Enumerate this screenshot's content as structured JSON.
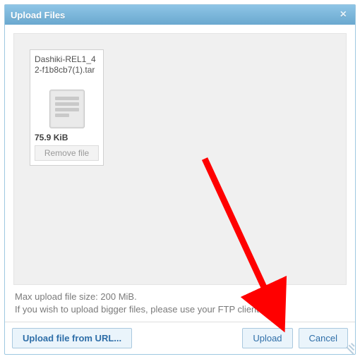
{
  "dialog": {
    "title": "Upload Files",
    "close_glyph": "×"
  },
  "file": {
    "name": "Dashiki-REL1_42-f1b8cb7(1).tar",
    "size": "75.9 KiB",
    "remove_label": "Remove file"
  },
  "info": {
    "max_line": "Max upload file size: 200 MiB.",
    "ftp_line": "If you wish to upload bigger files, please use your FTP client."
  },
  "footer": {
    "from_url_label": "Upload file from URL...",
    "upload_label": "Upload",
    "cancel_label": "Cancel"
  }
}
